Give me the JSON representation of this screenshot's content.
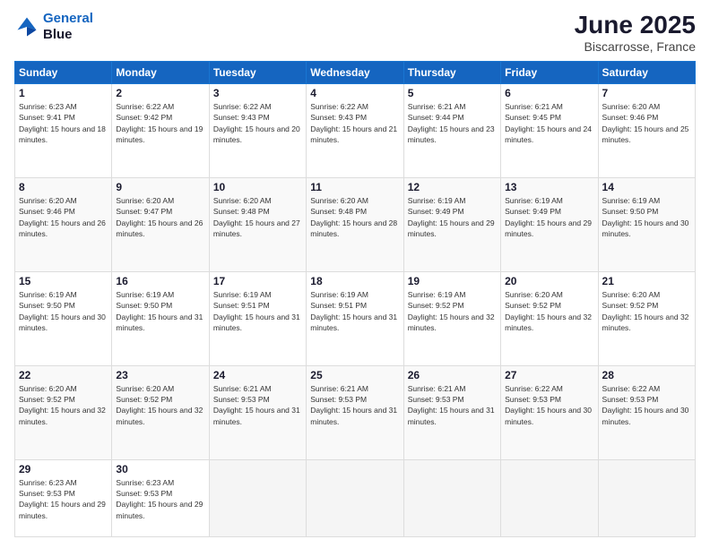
{
  "logo": {
    "line1": "General",
    "line2": "Blue"
  },
  "title": "June 2025",
  "subtitle": "Biscarrosse, France",
  "headers": [
    "Sunday",
    "Monday",
    "Tuesday",
    "Wednesday",
    "Thursday",
    "Friday",
    "Saturday"
  ],
  "weeks": [
    [
      {
        "day": "1",
        "sunrise": "6:23 AM",
        "sunset": "9:41 PM",
        "daylight": "15 hours and 18 minutes."
      },
      {
        "day": "2",
        "sunrise": "6:22 AM",
        "sunset": "9:42 PM",
        "daylight": "15 hours and 19 minutes."
      },
      {
        "day": "3",
        "sunrise": "6:22 AM",
        "sunset": "9:43 PM",
        "daylight": "15 hours and 20 minutes."
      },
      {
        "day": "4",
        "sunrise": "6:22 AM",
        "sunset": "9:43 PM",
        "daylight": "15 hours and 21 minutes."
      },
      {
        "day": "5",
        "sunrise": "6:21 AM",
        "sunset": "9:44 PM",
        "daylight": "15 hours and 23 minutes."
      },
      {
        "day": "6",
        "sunrise": "6:21 AM",
        "sunset": "9:45 PM",
        "daylight": "15 hours and 24 minutes."
      },
      {
        "day": "7",
        "sunrise": "6:20 AM",
        "sunset": "9:46 PM",
        "daylight": "15 hours and 25 minutes."
      }
    ],
    [
      {
        "day": "8",
        "sunrise": "6:20 AM",
        "sunset": "9:46 PM",
        "daylight": "15 hours and 26 minutes."
      },
      {
        "day": "9",
        "sunrise": "6:20 AM",
        "sunset": "9:47 PM",
        "daylight": "15 hours and 26 minutes."
      },
      {
        "day": "10",
        "sunrise": "6:20 AM",
        "sunset": "9:48 PM",
        "daylight": "15 hours and 27 minutes."
      },
      {
        "day": "11",
        "sunrise": "6:20 AM",
        "sunset": "9:48 PM",
        "daylight": "15 hours and 28 minutes."
      },
      {
        "day": "12",
        "sunrise": "6:19 AM",
        "sunset": "9:49 PM",
        "daylight": "15 hours and 29 minutes."
      },
      {
        "day": "13",
        "sunrise": "6:19 AM",
        "sunset": "9:49 PM",
        "daylight": "15 hours and 29 minutes."
      },
      {
        "day": "14",
        "sunrise": "6:19 AM",
        "sunset": "9:50 PM",
        "daylight": "15 hours and 30 minutes."
      }
    ],
    [
      {
        "day": "15",
        "sunrise": "6:19 AM",
        "sunset": "9:50 PM",
        "daylight": "15 hours and 30 minutes."
      },
      {
        "day": "16",
        "sunrise": "6:19 AM",
        "sunset": "9:50 PM",
        "daylight": "15 hours and 31 minutes."
      },
      {
        "day": "17",
        "sunrise": "6:19 AM",
        "sunset": "9:51 PM",
        "daylight": "15 hours and 31 minutes."
      },
      {
        "day": "18",
        "sunrise": "6:19 AM",
        "sunset": "9:51 PM",
        "daylight": "15 hours and 31 minutes."
      },
      {
        "day": "19",
        "sunrise": "6:19 AM",
        "sunset": "9:52 PM",
        "daylight": "15 hours and 32 minutes."
      },
      {
        "day": "20",
        "sunrise": "6:20 AM",
        "sunset": "9:52 PM",
        "daylight": "15 hours and 32 minutes."
      },
      {
        "day": "21",
        "sunrise": "6:20 AM",
        "sunset": "9:52 PM",
        "daylight": "15 hours and 32 minutes."
      }
    ],
    [
      {
        "day": "22",
        "sunrise": "6:20 AM",
        "sunset": "9:52 PM",
        "daylight": "15 hours and 32 minutes."
      },
      {
        "day": "23",
        "sunrise": "6:20 AM",
        "sunset": "9:52 PM",
        "daylight": "15 hours and 32 minutes."
      },
      {
        "day": "24",
        "sunrise": "6:21 AM",
        "sunset": "9:53 PM",
        "daylight": "15 hours and 31 minutes."
      },
      {
        "day": "25",
        "sunrise": "6:21 AM",
        "sunset": "9:53 PM",
        "daylight": "15 hours and 31 minutes."
      },
      {
        "day": "26",
        "sunrise": "6:21 AM",
        "sunset": "9:53 PM",
        "daylight": "15 hours and 31 minutes."
      },
      {
        "day": "27",
        "sunrise": "6:22 AM",
        "sunset": "9:53 PM",
        "daylight": "15 hours and 30 minutes."
      },
      {
        "day": "28",
        "sunrise": "6:22 AM",
        "sunset": "9:53 PM",
        "daylight": "15 hours and 30 minutes."
      }
    ],
    [
      {
        "day": "29",
        "sunrise": "6:23 AM",
        "sunset": "9:53 PM",
        "daylight": "15 hours and 29 minutes."
      },
      {
        "day": "30",
        "sunrise": "6:23 AM",
        "sunset": "9:53 PM",
        "daylight": "15 hours and 29 minutes."
      },
      null,
      null,
      null,
      null,
      null
    ]
  ]
}
